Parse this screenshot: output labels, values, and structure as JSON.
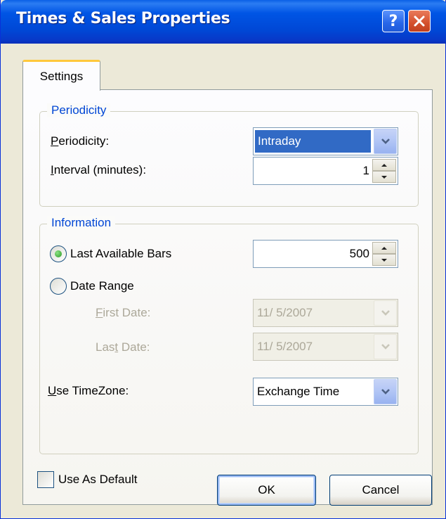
{
  "window": {
    "title": "Times & Sales Properties",
    "help_glyph": "?",
    "close_glyph": "×"
  },
  "tab": {
    "label": "Settings"
  },
  "periodicity_group": {
    "legend": "Periodicity",
    "periodicity_label_ul": "P",
    "periodicity_label_rest": "eriodicity:",
    "periodicity_value": "Intraday",
    "interval_label_ul": "I",
    "interval_label_rest": "nterval (minutes):",
    "interval_value": "1"
  },
  "information_group": {
    "legend": "Information",
    "last_bars_label": "Last Available Bars",
    "last_bars_value": "500",
    "last_bars_selected": true,
    "date_range_label": "Date Range",
    "first_date_label_ul": "F",
    "first_date_label_rest": "irst Date:",
    "first_date_value": "11/  5/2007",
    "last_date_label_pre": "Las",
    "last_date_label_ul": "t",
    "last_date_label_rest": " Date:",
    "last_date_value": "11/  5/2007",
    "timezone_label_ul": "U",
    "timezone_label_rest": "se TimeZone:",
    "timezone_value": "Exchange Time"
  },
  "use_default": {
    "label": "Use As Default",
    "checked": false
  },
  "buttons": {
    "ok": "OK",
    "cancel": "Cancel"
  },
  "colors": {
    "titlebar": "#0054e3",
    "legend_text": "#0046d5",
    "selection": "#316ac5",
    "tab_highlight": "#ffc83c",
    "close_button": "#d4502c"
  }
}
